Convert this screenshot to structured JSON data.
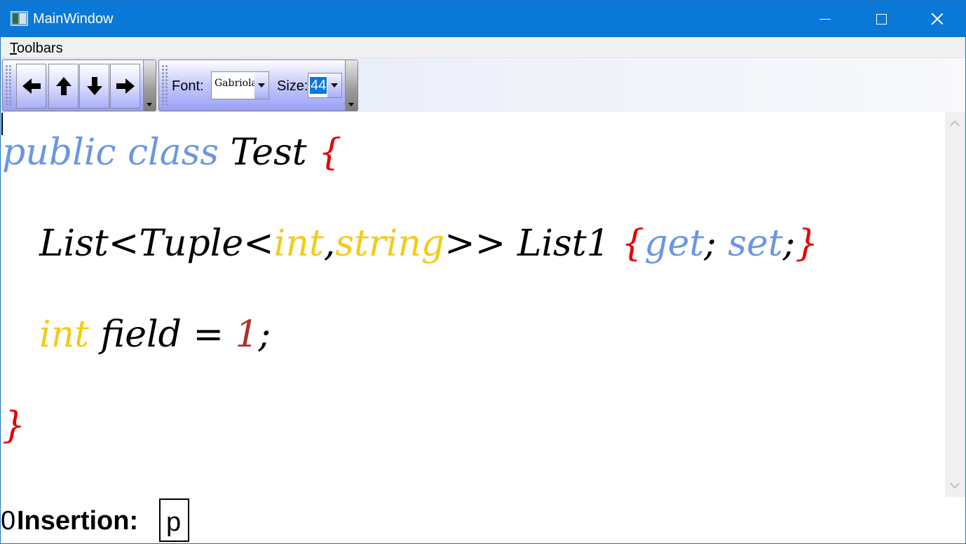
{
  "window": {
    "title": "MainWindow"
  },
  "menu": {
    "toolbars_accel": "T",
    "toolbars_rest": "oolbars"
  },
  "toolbar": {
    "font_label": "Font:",
    "font_value": "Gabriola",
    "size_label": "Size:",
    "size_value": "44"
  },
  "code": {
    "line1": {
      "kw1": "public",
      "kw2": "class",
      "name": "Test",
      "brace": "{"
    },
    "line2": {
      "t1": "List<Tuple<",
      "ty1": "int",
      "comma": ",",
      "ty2": "string",
      "t2": ">> List1 ",
      "bo": "{",
      "kw_get": "get",
      "semi1": "; ",
      "kw_set": "set",
      "semi2": ";",
      "bc": "}"
    },
    "line3": {
      "ty": "int",
      "name": " field = ",
      "num": "1",
      "semi": ";"
    },
    "line4": {
      "brace": "}"
    }
  },
  "status": {
    "count": "0",
    "label": "Insertion:",
    "char": "p"
  },
  "colors": {
    "keyword": "#6b96e4",
    "type": "#f2cc16",
    "brace": "#e60000",
    "number": "#a8322c",
    "titlebar": "#0a78d7"
  }
}
